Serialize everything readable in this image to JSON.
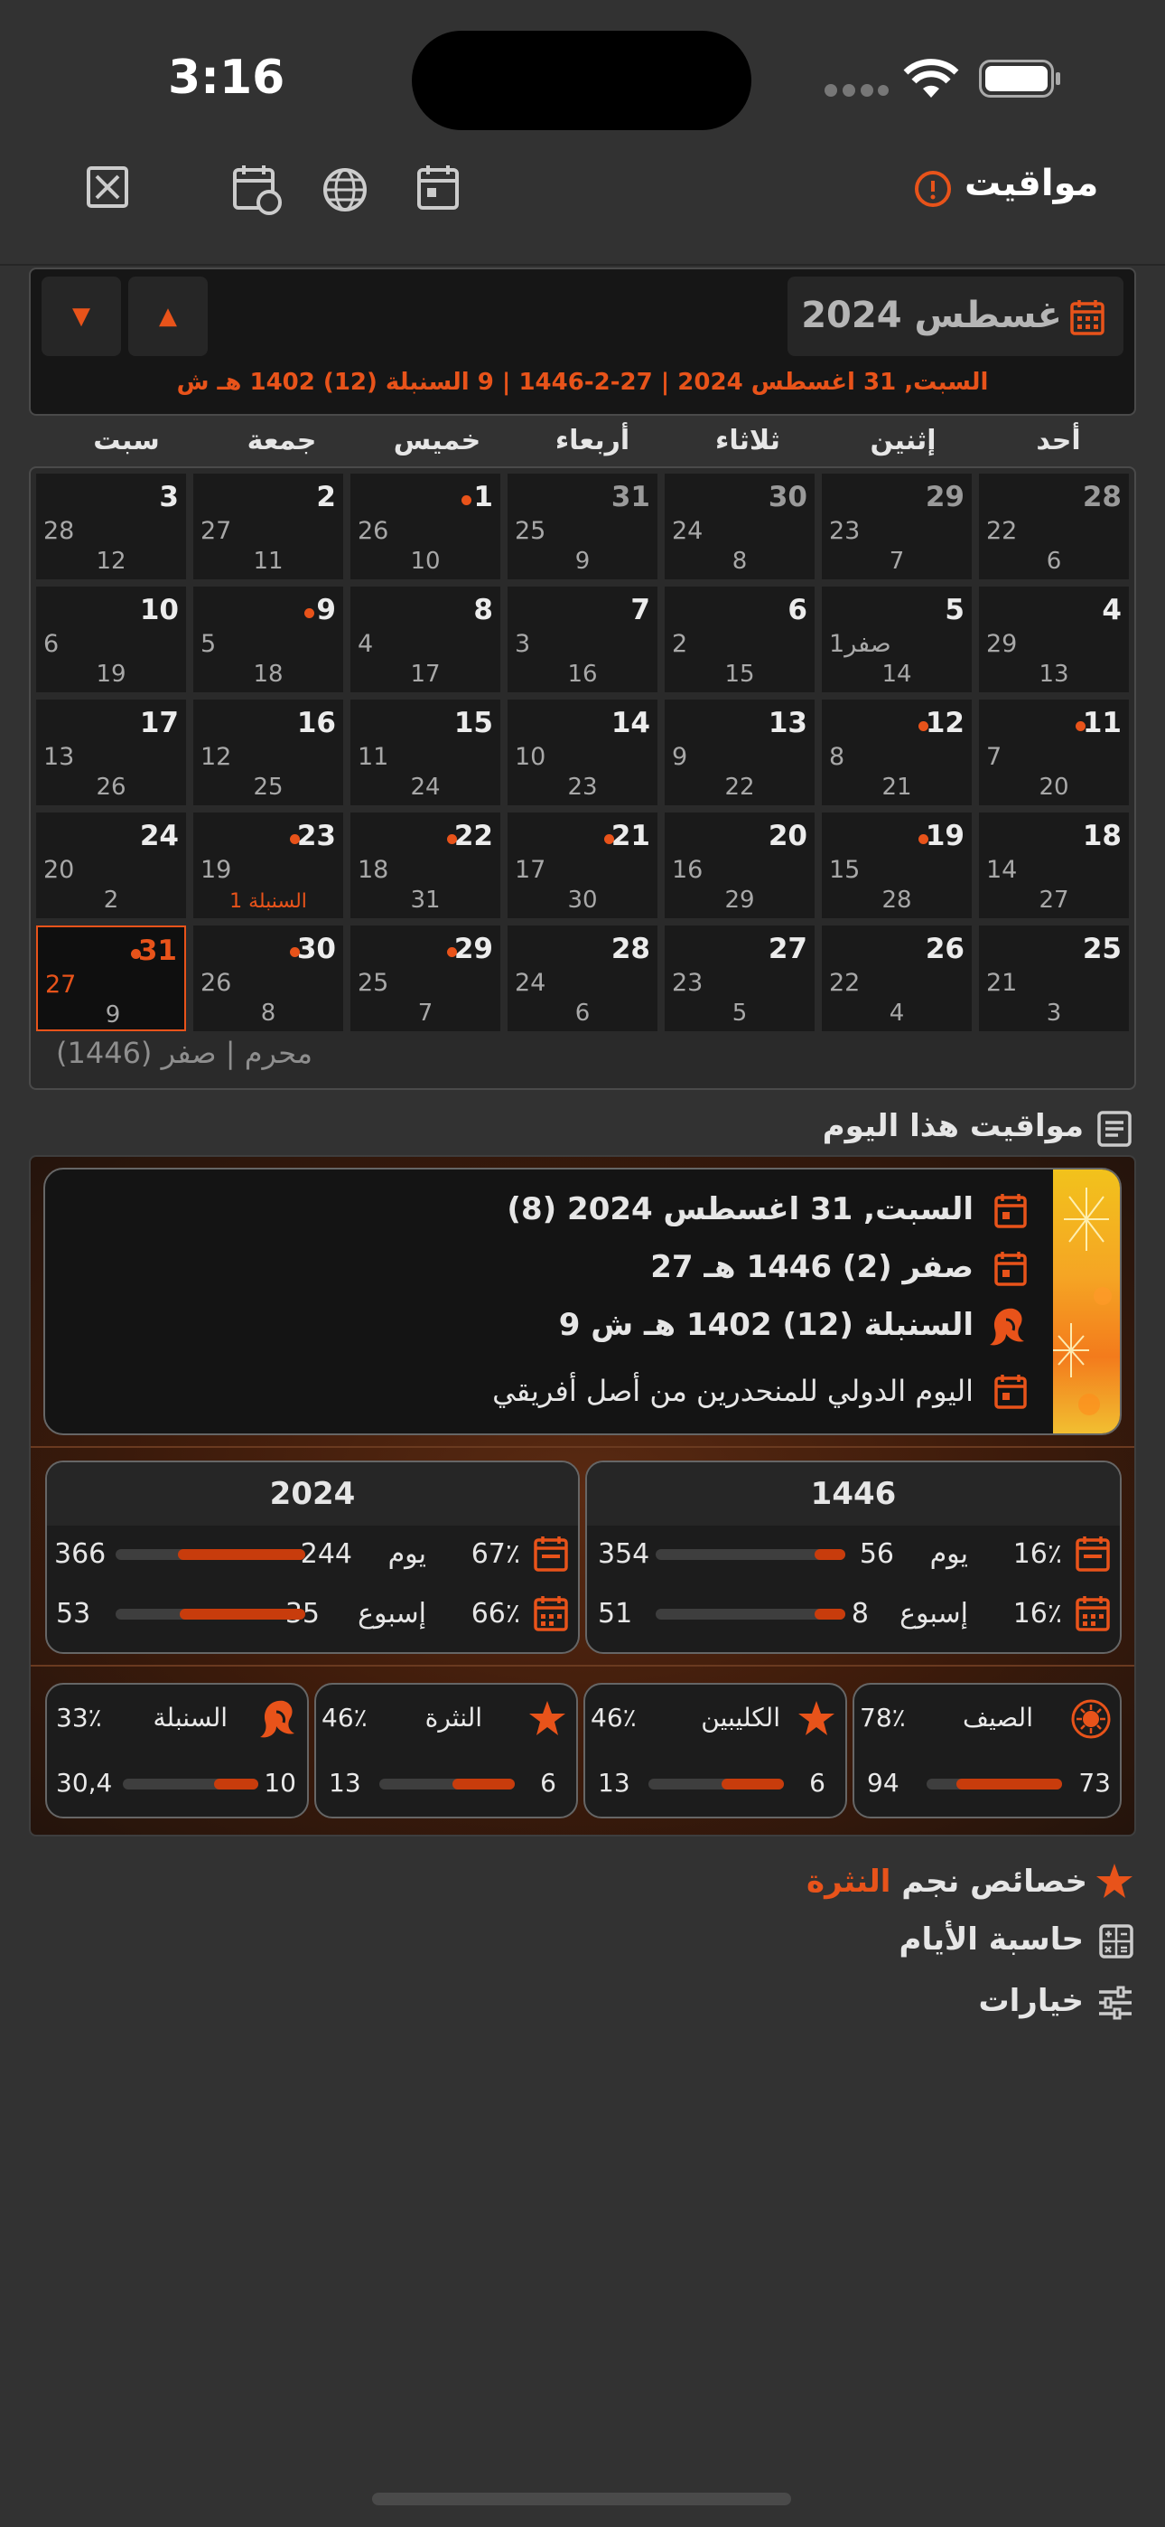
{
  "status": {
    "time": "3:16"
  },
  "header": {
    "title": "مواقيت"
  },
  "month_header": {
    "title": "غسطس 2024",
    "up": "▲",
    "down": "▼",
    "subtitle": "السبت, 31 اغسطس 2024 | 27-2-1446 | 9 السنبلة (12) 1402 هـ ش"
  },
  "weekdays": [
    "أحد",
    "إثنين",
    "ثلاثاء",
    "أربعاء",
    "خميس",
    "جمعة",
    "سبت"
  ],
  "calendar": {
    "rows": [
      [
        {
          "d": "28",
          "h": "22",
          "s": "6",
          "dim": true
        },
        {
          "d": "29",
          "h": "23",
          "s": "7",
          "dim": true
        },
        {
          "d": "30",
          "h": "24",
          "s": "8",
          "dim": true
        },
        {
          "d": "31",
          "h": "25",
          "s": "9",
          "dim": true
        },
        {
          "d": "1",
          "h": "26",
          "s": "10",
          "dot": true
        },
        {
          "d": "2",
          "h": "27",
          "s": "11"
        },
        {
          "d": "3",
          "h": "28",
          "s": "12"
        }
      ],
      [
        {
          "d": "4",
          "h": "29",
          "s": "13"
        },
        {
          "d": "5",
          "h": "1صفر",
          "s": "14"
        },
        {
          "d": "6",
          "h": "2",
          "s": "15"
        },
        {
          "d": "7",
          "h": "3",
          "s": "16"
        },
        {
          "d": "8",
          "h": "4",
          "s": "17"
        },
        {
          "d": "9",
          "h": "5",
          "s": "18",
          "dot": true
        },
        {
          "d": "10",
          "h": "6",
          "s": "19"
        }
      ],
      [
        {
          "d": "11",
          "h": "7",
          "s": "20",
          "dot": true
        },
        {
          "d": "12",
          "h": "8",
          "s": "21",
          "dot": true
        },
        {
          "d": "13",
          "h": "9",
          "s": "22"
        },
        {
          "d": "14",
          "h": "10",
          "s": "23"
        },
        {
          "d": "15",
          "h": "11",
          "s": "24"
        },
        {
          "d": "16",
          "h": "12",
          "s": "25"
        },
        {
          "d": "17",
          "h": "13",
          "s": "26"
        }
      ],
      [
        {
          "d": "18",
          "h": "14",
          "s": "27"
        },
        {
          "d": "19",
          "h": "15",
          "s": "28",
          "dot": true
        },
        {
          "d": "20",
          "h": "16",
          "s": "29"
        },
        {
          "d": "21",
          "h": "17",
          "s": "30",
          "dot": true
        },
        {
          "d": "22",
          "h": "18",
          "s": "31",
          "dot": true
        },
        {
          "d": "23",
          "h": "19",
          "s": "1 السنبلة",
          "dot": true,
          "sign": true
        },
        {
          "d": "24",
          "h": "20",
          "s": "2"
        }
      ],
      [
        {
          "d": "25",
          "h": "21",
          "s": "3"
        },
        {
          "d": "26",
          "h": "22",
          "s": "4"
        },
        {
          "d": "27",
          "h": "23",
          "s": "5"
        },
        {
          "d": "28",
          "h": "24",
          "s": "6"
        },
        {
          "d": "29",
          "h": "25",
          "s": "7",
          "dot": true
        },
        {
          "d": "30",
          "h": "26",
          "s": "8",
          "dot": true
        },
        {
          "d": "31",
          "h": "27",
          "s": "9",
          "dot": true,
          "today": true
        }
      ]
    ],
    "footer": "محرم | صفر (1446)"
  },
  "today_section": {
    "heading": "مواقيت هذا اليوم",
    "gregorian": "السبت, 31 اغسطس 2024 (8)",
    "hijri": "27 صفر (2) 1446 هـ",
    "solar": "9 السنبلة (12) 1402 هـ ش",
    "event": "اليوم الدولي للمنحدرين من أصل أفريقي"
  },
  "year_cards": [
    {
      "year": "1446",
      "day": {
        "pct": "16٪",
        "label": "يوم",
        "value": "56",
        "total": "354",
        "fraction": 0.16
      },
      "week": {
        "pct": "16٪",
        "label": "إسبوع",
        "value": "8",
        "total": "51",
        "fraction": 0.16
      }
    },
    {
      "year": "2024",
      "day": {
        "pct": "67٪",
        "label": "يوم",
        "value": "244",
        "total": "366",
        "fraction": 0.67
      },
      "week": {
        "pct": "66٪",
        "label": "إسبوع",
        "value": "35",
        "total": "53",
        "fraction": 0.66
      }
    }
  ],
  "season_cards": [
    {
      "name": "الصيف",
      "pct": "78٪",
      "value": "73",
      "total": "94",
      "fraction": 0.78,
      "icon": "sun-icon"
    },
    {
      "name": "الكليبين",
      "pct": "46٪",
      "value": "6",
      "total": "13",
      "fraction": 0.46,
      "icon": "star-icon"
    },
    {
      "name": "النثرة",
      "pct": "46٪",
      "value": "6",
      "total": "13",
      "fraction": 0.46,
      "icon": "star-icon"
    },
    {
      "name": "السنبلة",
      "pct": "33٪",
      "value": "10",
      "total": "30,4",
      "fraction": 0.33,
      "icon": "virgo-icon"
    }
  ],
  "links": {
    "star_prefix": "خصائص نجم",
    "star_name": "النثرة",
    "day_calc": "حاسبة الأيام",
    "options": "خيارات"
  },
  "colors": {
    "accent": "#e8531a",
    "background": "#323232",
    "cell": "#1a1a1a"
  }
}
